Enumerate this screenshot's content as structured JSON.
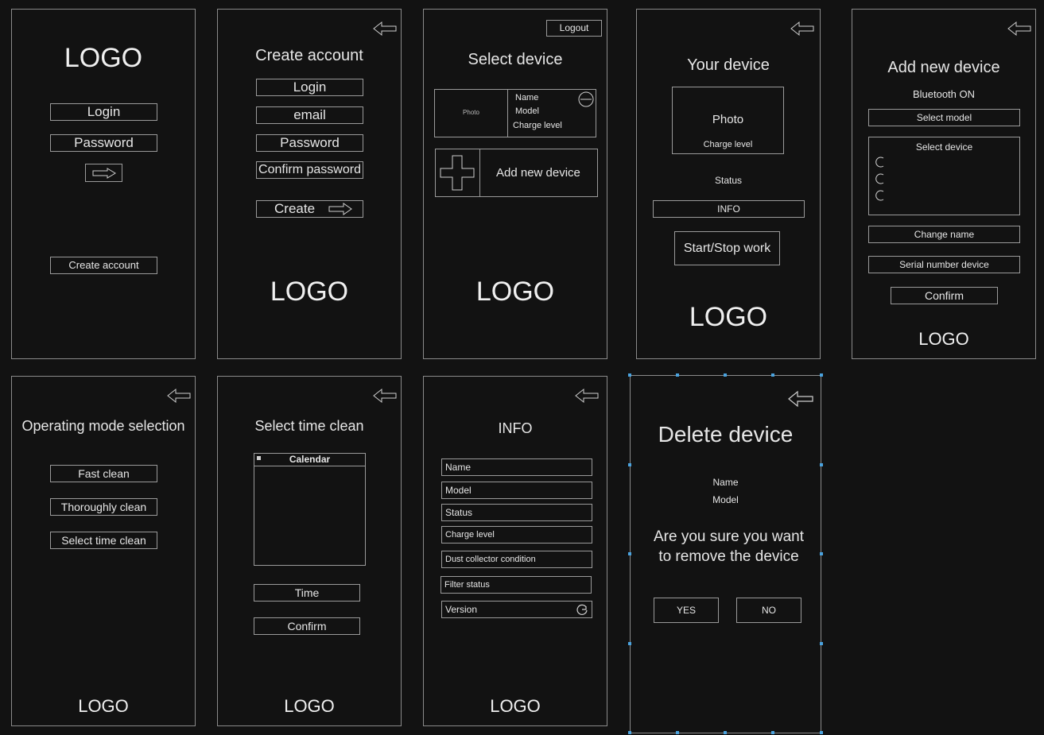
{
  "accent_handle_color": "#4aa3df",
  "s1": {
    "logo": "LOGO",
    "login": "Login",
    "password": "Password",
    "create_account": "Create account"
  },
  "s2": {
    "title": "Create account",
    "login": "Login",
    "email": "email",
    "password": "Password",
    "confirm_password": "Confirm password",
    "create": "Create",
    "logo": "LOGO"
  },
  "s3": {
    "logout": "Logout",
    "title": "Select device",
    "photo": "Photo",
    "name": "Name",
    "model": "Model",
    "charge_level": "Charge level",
    "add_new_device": "Add new device",
    "logo": "LOGO"
  },
  "s4": {
    "title": "Your device",
    "photo": "Photo",
    "charge_level": "Charge level",
    "status": "Status",
    "info": "INFO",
    "start_stop": "Start/Stop work",
    "logo": "LOGO"
  },
  "s5": {
    "title": "Add new device",
    "bluetooth": "Bluetooth ON",
    "select_model": "Select model",
    "select_device": "Select device",
    "change_name": "Change name",
    "serial_number": "Serial number device",
    "confirm": "Confirm",
    "logo": "LOGO"
  },
  "s6": {
    "title": "Operating mode selection",
    "fast_clean": "Fast clean",
    "thoroughly_clean": "Thoroughly clean",
    "select_time_clean": "Select time clean",
    "logo": "LOGO"
  },
  "s7": {
    "title": "Select time clean",
    "calendar": "Calendar",
    "time": "Time",
    "confirm": "Confirm",
    "logo": "LOGO"
  },
  "s8": {
    "title": "INFO",
    "name": "Name",
    "model": "Model",
    "status": "Status",
    "charge_level": "Charge level",
    "dust_collector": "Dust collector condition",
    "filter_status": "Filter status",
    "version": "Version",
    "logo": "LOGO"
  },
  "s9": {
    "title": "Delete device",
    "name": "Name",
    "model": "Model",
    "question_line1": "Are you sure you want",
    "question_line2": "to remove the device",
    "yes": "YES",
    "no": "NO"
  }
}
